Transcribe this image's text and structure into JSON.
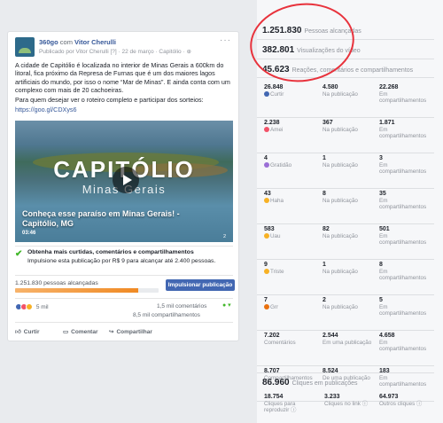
{
  "post": {
    "page_name": "360go",
    "with_text": "com",
    "person": "Vitor Cherulli",
    "published_by": "Publicado por Vitor Cherulli",
    "meta": "[?] · 22 de março · Capitólio · ",
    "body": [
      "A cidade de Capitólio é localizada no interior de Minas Gerais a 600km do litoral, fica próximo da Represa de Furnas que é um dos maiores lagos artificiais do mundo, por isso o nome “Mar de Minas”. E ainda conta com um complexo com mais de 20 cachoeiras.",
      "Para quem desejar ver o roteiro completo e participar dos sorteios:"
    ],
    "link": "https://goo.gl/CDXys6",
    "video": {
      "title": "CAPITÓLIO",
      "subtitle": "Minas Gerais",
      "caption": "Conheça esse paraíso em Minas Gerais! - Capitólio, MG",
      "duration": "03:46",
      "corner": "2"
    },
    "boost": {
      "title": "Obtenha mais curtidas, comentários e compartilhamentos",
      "desc": "Impulsione esta publicação por R$ 9 para alcançar até 2.400 pessoas.",
      "reach_label": "1.251.830 pessoas alcançadas",
      "reach_fraction": 0.86,
      "button": "Impulsionar publicação"
    },
    "reactions_count": "5 mil",
    "comments": "1,5 mil comentários",
    "shares": "8,5 mil compartilhamentos",
    "actions": {
      "like": "Curtir",
      "comment": "Comentar",
      "share": "Compartilhar"
    }
  },
  "stats": {
    "reach": {
      "value": "1.251.830",
      "label": "Pessoas alcançadas"
    },
    "views": {
      "value": "382.801",
      "label": "Visualizações do vídeo"
    },
    "engagement": {
      "value": "45.623",
      "label": "Reações, comentários e compartilhamentos"
    },
    "rows": [
      {
        "name": "Curtir",
        "color": "#4267b2",
        "total": "26.848",
        "on_post": "4.580",
        "on_shares": "22.268"
      },
      {
        "name": "Amei",
        "color": "#f25268",
        "total": "2.238",
        "on_post": "367",
        "on_shares": "1.871"
      },
      {
        "name": "Gratidão",
        "color": "#9b6fd6",
        "total": "4",
        "on_post": "1",
        "on_shares": "3"
      },
      {
        "name": "Haha",
        "color": "#f7b125",
        "total": "43",
        "on_post": "8",
        "on_shares": "35"
      },
      {
        "name": "Uau",
        "color": "#f7b125",
        "total": "583",
        "on_post": "82",
        "on_shares": "501"
      },
      {
        "name": "Triste",
        "color": "#f7b125",
        "total": "9",
        "on_post": "1",
        "on_shares": "8"
      },
      {
        "name": "Grr",
        "color": "#e9710f",
        "total": "7",
        "on_post": "2",
        "on_shares": "5"
      }
    ],
    "col_on_post": "Na publicação",
    "col_on_shares": "Em compartilhamentos",
    "comments_row": {
      "label": "Comentários",
      "total": "7.202",
      "on_post": "2.544",
      "on_post_label": "Em uma publicação",
      "on_shares": "4.658",
      "on_shares_label": "Em compartilhamentos"
    },
    "shares_row": {
      "label": "Compartilhamentos",
      "total": "8.707",
      "on_post": "8.524",
      "on_post_label": "De uma publicação",
      "on_shares": "183",
      "on_shares_label": "Em compartilhamentos"
    },
    "clicks": {
      "value": "86.960",
      "label": "Cliques em publicações"
    },
    "click_rows": [
      {
        "value": "18.754",
        "label": "Cliques para reproduzir"
      },
      {
        "value": "3.233",
        "label": "Cliques no link"
      },
      {
        "value": "64.973",
        "label": "Outros cliques"
      }
    ]
  }
}
